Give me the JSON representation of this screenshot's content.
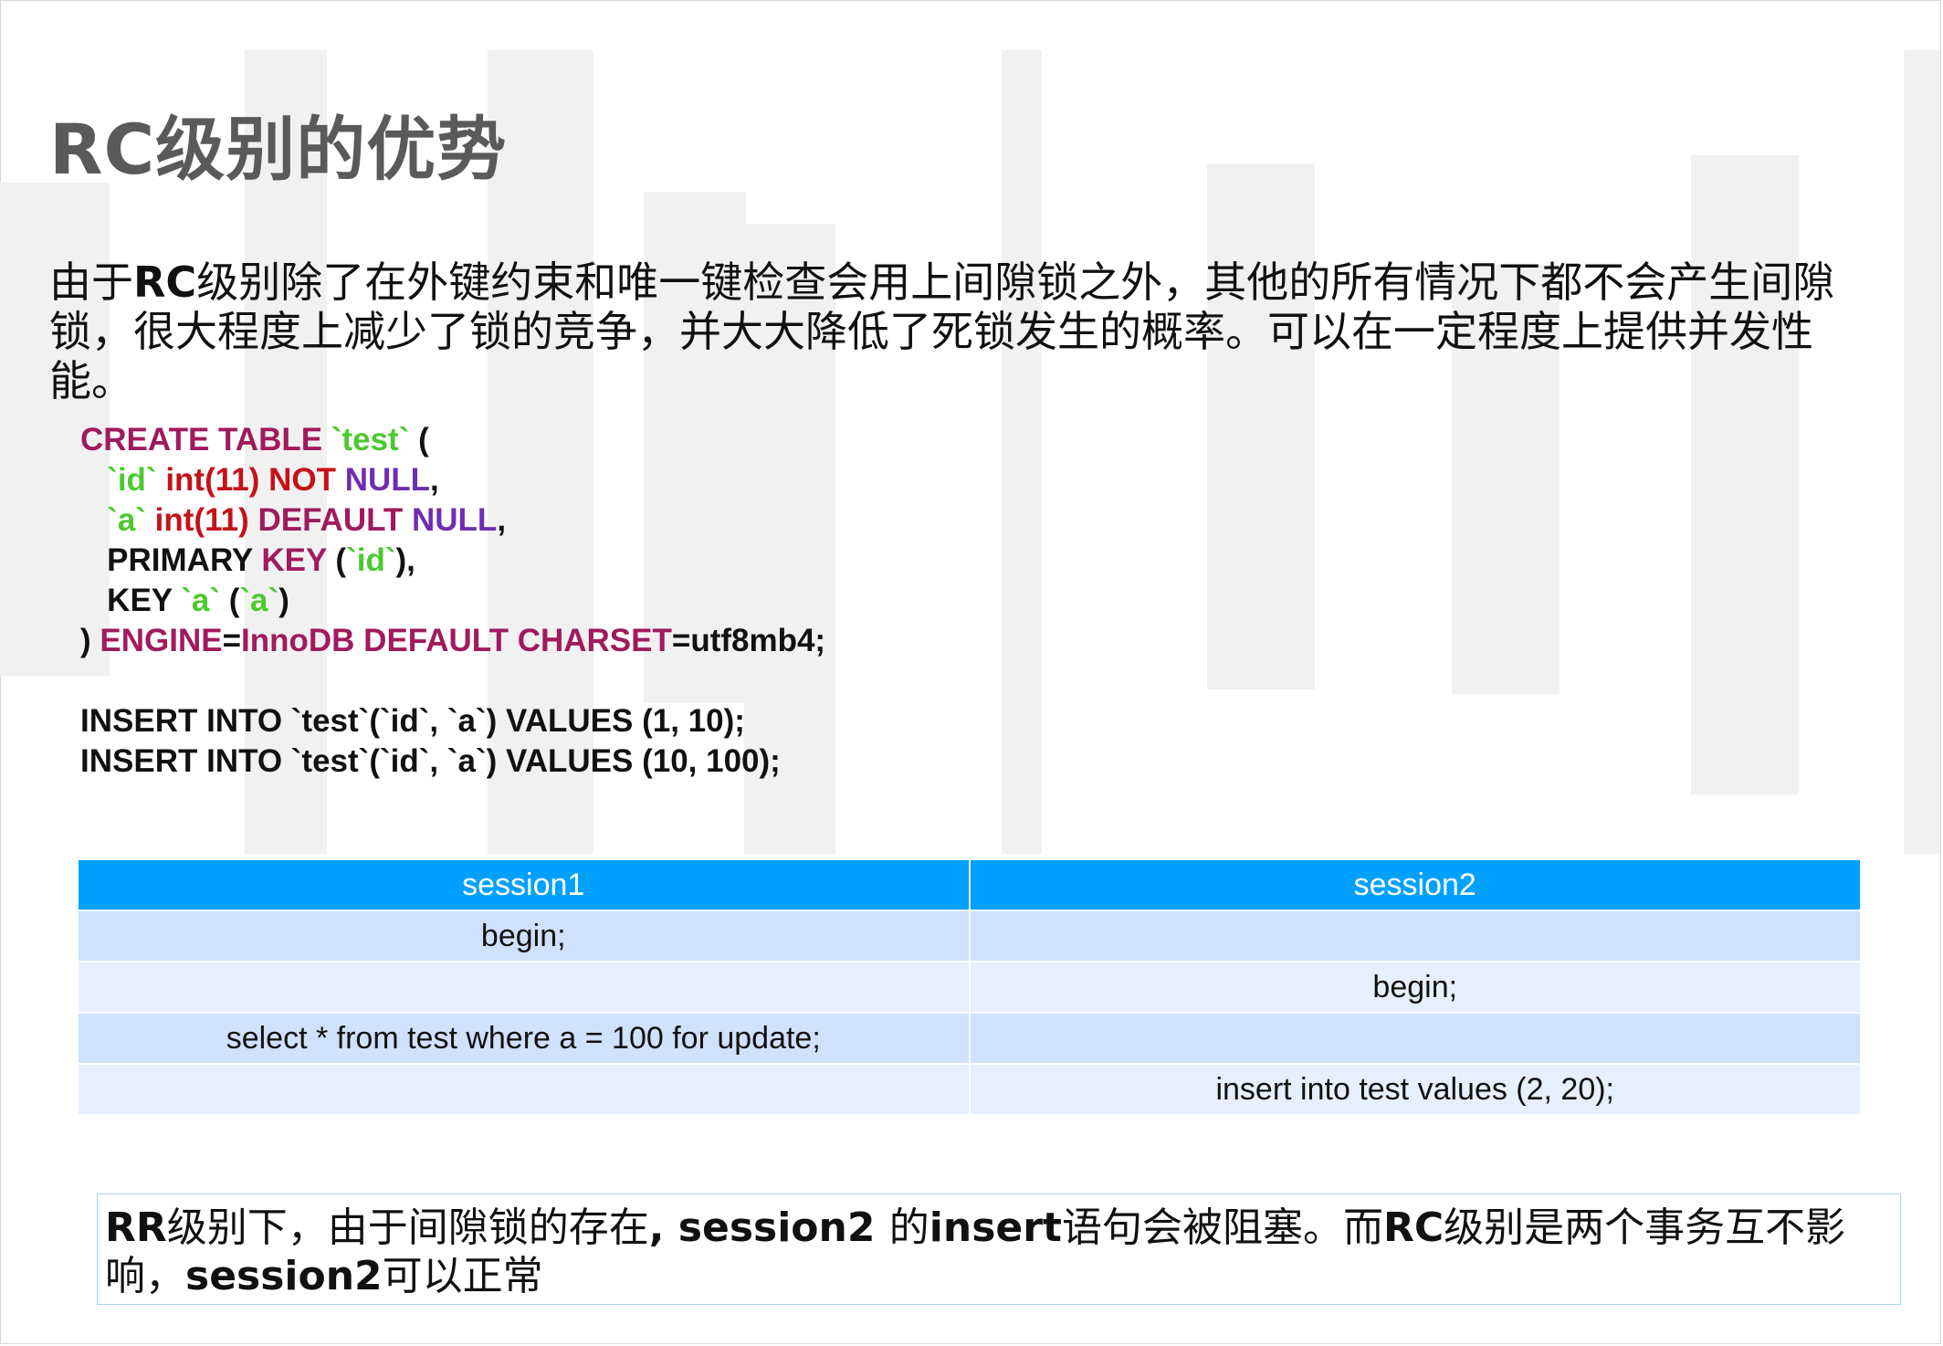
{
  "slide": {
    "title": "RC级别的优势",
    "intro": {
      "p1": "由于",
      "b1": "RC",
      "p2": "级别除了在外键约束和唯一键检查会用上间隙锁之外，其他的所有情况下都不会产生间隙锁，很大程度上减少了锁的竞争，并大大降低了死锁发生的概率。可以在一定程度上提供并发性能。"
    },
    "code": {
      "l1": {
        "a": "CREATE TABLE",
        "b": " `test`",
        "c": " ("
      },
      "l2": {
        "a": "   `id`",
        "b": " int(11)",
        "c": " NOT",
        "d": " NULL",
        "e": ","
      },
      "l3": {
        "a": "   `a`",
        "b": " int(11)",
        "c": " DEFAULT",
        "d": " NULL",
        "e": ","
      },
      "l4": {
        "a": "   PRIMARY",
        "b": " KEY",
        "c": " (",
        "d": "`id`",
        "e": "),"
      },
      "l5": {
        "a": "   KEY",
        "b": " `a`",
        "c": " (",
        "d": "`a`",
        "e": ")"
      },
      "l6": {
        "a": ") ",
        "b": "ENGINE",
        "c": "=",
        "d": "InnoDB DEFAULT CHARSET",
        "e": "=utf8mb4;"
      },
      "l7": "INSERT INTO `test`(`id`, `a`) VALUES (1, 10);",
      "l8": "INSERT INTO `test`(`id`, `a`) VALUES (10, 100);"
    },
    "table": {
      "headers": [
        "session1",
        "session2"
      ],
      "rows": [
        [
          "begin;",
          ""
        ],
        [
          "",
          "begin;"
        ],
        [
          "select * from test where a = 100 for update;",
          ""
        ],
        [
          "",
          "insert into test values (2, 20);"
        ]
      ]
    },
    "note": {
      "b1": "RR",
      "p1": "级别下，由于间隙锁的存在",
      "b2": ", session2 ",
      "p2": "的",
      "b3": "insert",
      "p3": "语句会被阻塞。而",
      "b4": "RC",
      "p4": "级别是两个事务互不影响，",
      "b5": "session2",
      "p5": "可以正常"
    }
  }
}
